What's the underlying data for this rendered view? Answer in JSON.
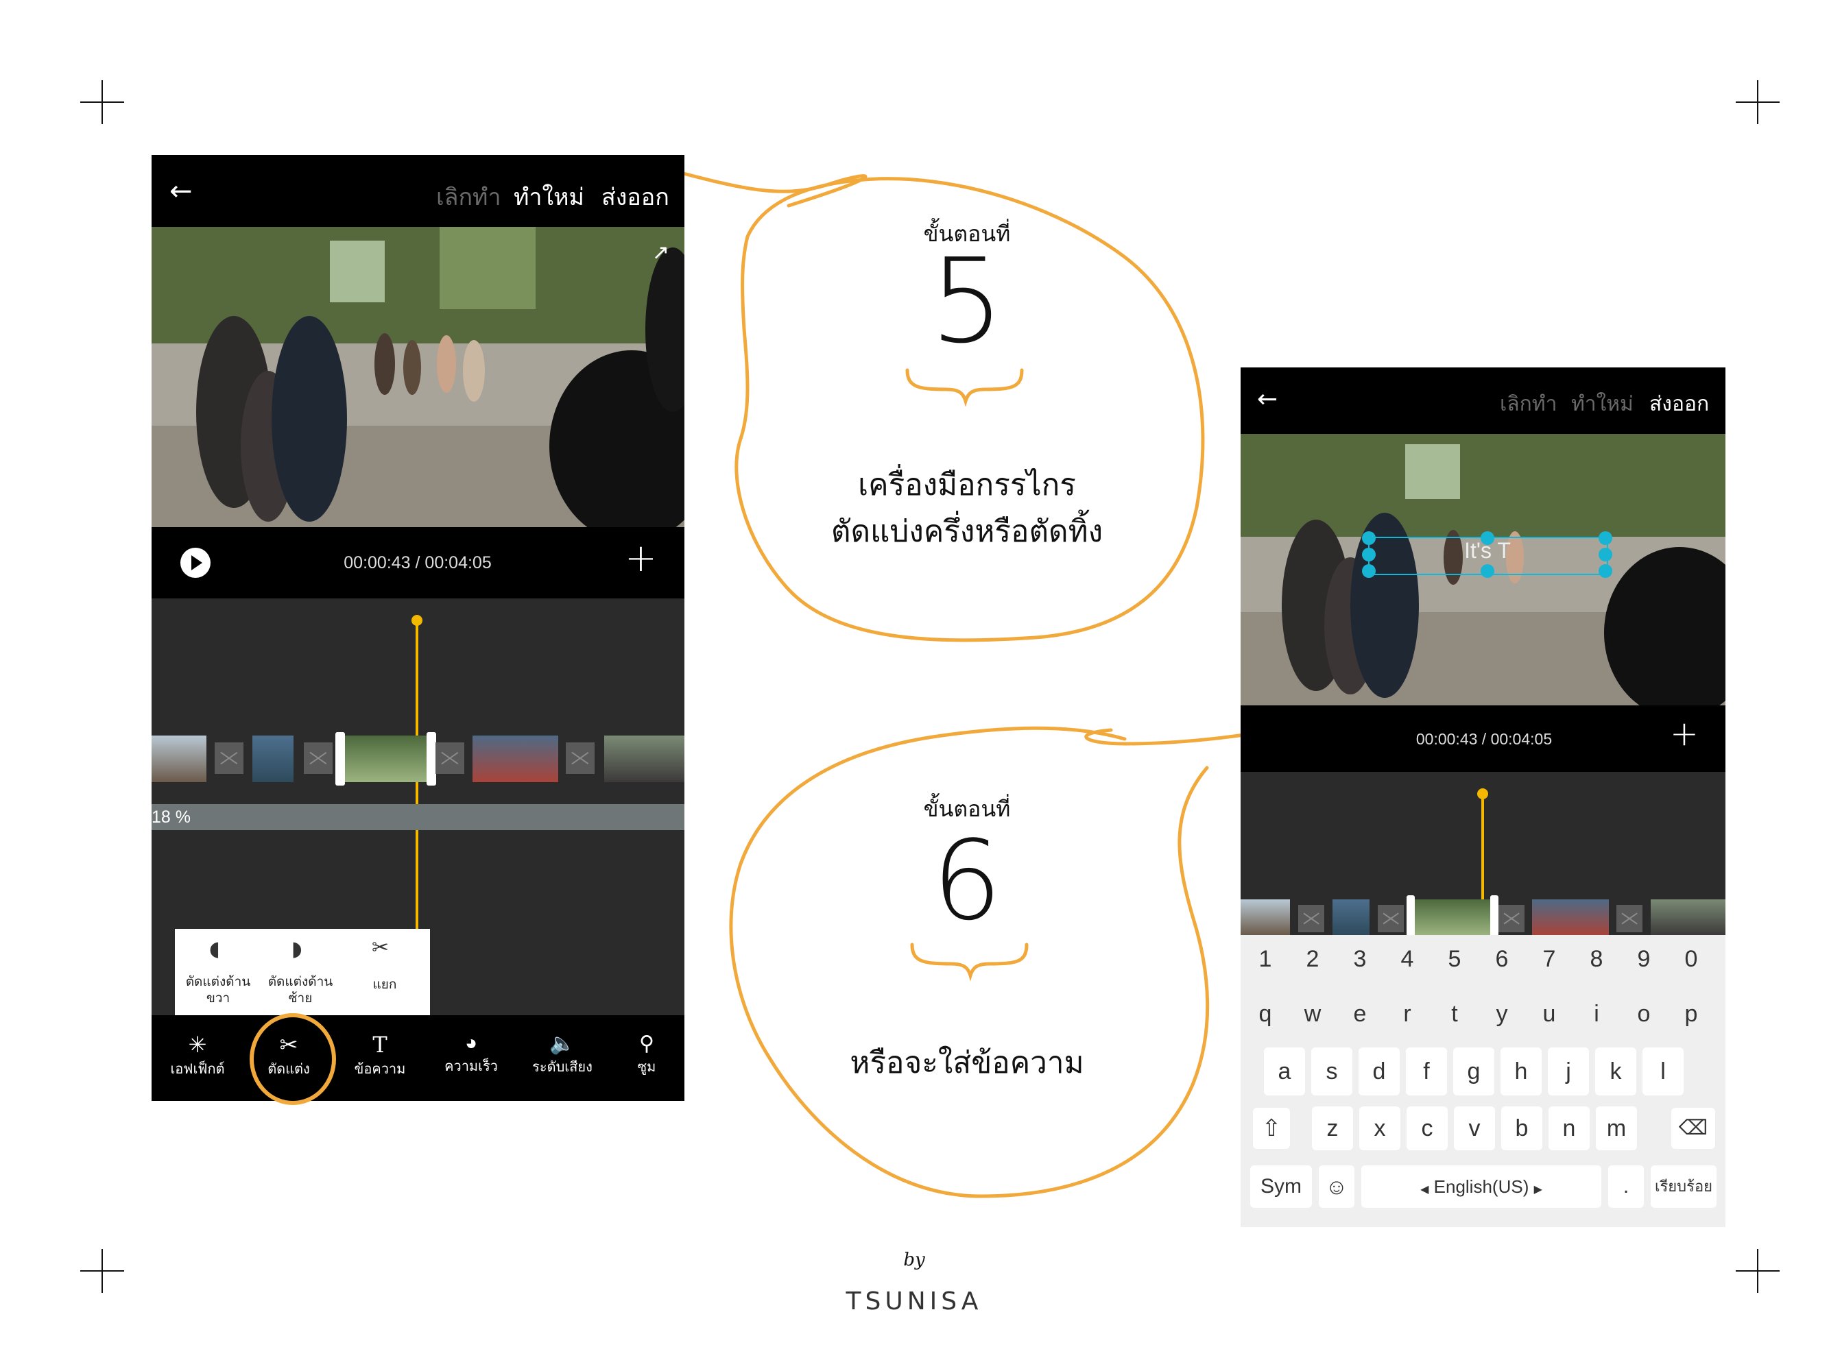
{
  "left_phone": {
    "back_icon": "arrow-left-icon",
    "undo": "เลิกทำ",
    "redo": "ทำใหม่",
    "export": "ส่งออก",
    "time": "00:00:43 / 00:04:05",
    "progress_label": "18 %",
    "popup": {
      "trim_right": "ตัดแต่งด้านขวา",
      "trim_left": "ตัดแต่งด้านซ้าย",
      "split": "แยก"
    },
    "toolbar": [
      {
        "label": "เอฟเฟ็กต์",
        "icon": "sparkle-icon"
      },
      {
        "label": "ตัดแต่ง",
        "icon": "scissors-icon"
      },
      {
        "label": "ข้อความ",
        "icon": "text-icon"
      },
      {
        "label": "ความเร็ว",
        "icon": "speed-icon"
      },
      {
        "label": "ระดับเสียง",
        "icon": "volume-icon"
      },
      {
        "label": "ซูม",
        "icon": "zoom-icon"
      }
    ]
  },
  "right_phone": {
    "undo": "เลิกทำ",
    "redo": "ทำใหม่",
    "export": "ส่งออก",
    "time": "00:00:43 / 00:04:05",
    "overlay_text": "It's T",
    "keyboard": {
      "numbers": [
        "1",
        "2",
        "3",
        "4",
        "5",
        "6",
        "7",
        "8",
        "9",
        "0"
      ],
      "row1": [
        "q",
        "w",
        "e",
        "r",
        "t",
        "y",
        "u",
        "i",
        "o",
        "p"
      ],
      "row2": [
        "a",
        "s",
        "d",
        "f",
        "g",
        "h",
        "j",
        "k",
        "l"
      ],
      "row3": [
        "z",
        "x",
        "c",
        "v",
        "b",
        "n",
        "m"
      ],
      "sym": "Sym",
      "space": "English(US)",
      "period": ".",
      "done": "เรียบร้อย"
    }
  },
  "step5": {
    "label": "ขั้นตอนที่",
    "number": "5",
    "line1": "เครื่องมือกรรไกร",
    "line2": "ตัดแบ่งครึ่งหรือตัดทิ้ง"
  },
  "step6": {
    "label": "ขั้นตอนที่",
    "number": "6",
    "line1": "หรือจะใส่ข้อความ"
  },
  "credit": {
    "by": "by",
    "name": "TSUNISA"
  },
  "colors": {
    "accent": "#F2A93B",
    "playhead": "#F5B800",
    "selection": "#18B4D4"
  }
}
